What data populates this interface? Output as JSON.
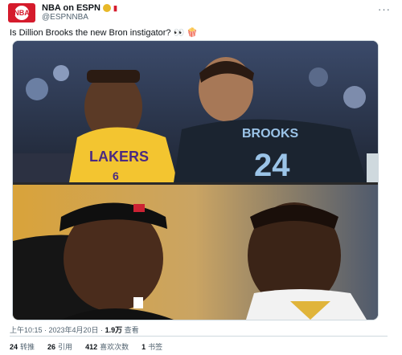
{
  "account": {
    "display_name": "NBA on ESPN",
    "handle": "@ESPNNBA",
    "avatar_icon": "espn-nba-logo",
    "verified_color": "#e8b829"
  },
  "tweet": {
    "text": "Is Dillion Brooks the new Bron instigator? 👀 🍿",
    "timestamp": "上午10:15 · 2023年4月20日 · ",
    "views_count": "1.9万",
    "views_label": " 查看"
  },
  "photos": {
    "top": {
      "jersey_left": "LAKERS",
      "jersey_right_name": "BROOKS",
      "jersey_right_number": "24"
    },
    "bottom": {}
  },
  "stats": [
    {
      "count": "24",
      "label": "转推"
    },
    {
      "count": "26",
      "label": "引用"
    },
    {
      "count": "412",
      "label": "喜欢次数"
    },
    {
      "count": "1",
      "label": "书签"
    }
  ],
  "more_icon": "ellipsis-icon"
}
